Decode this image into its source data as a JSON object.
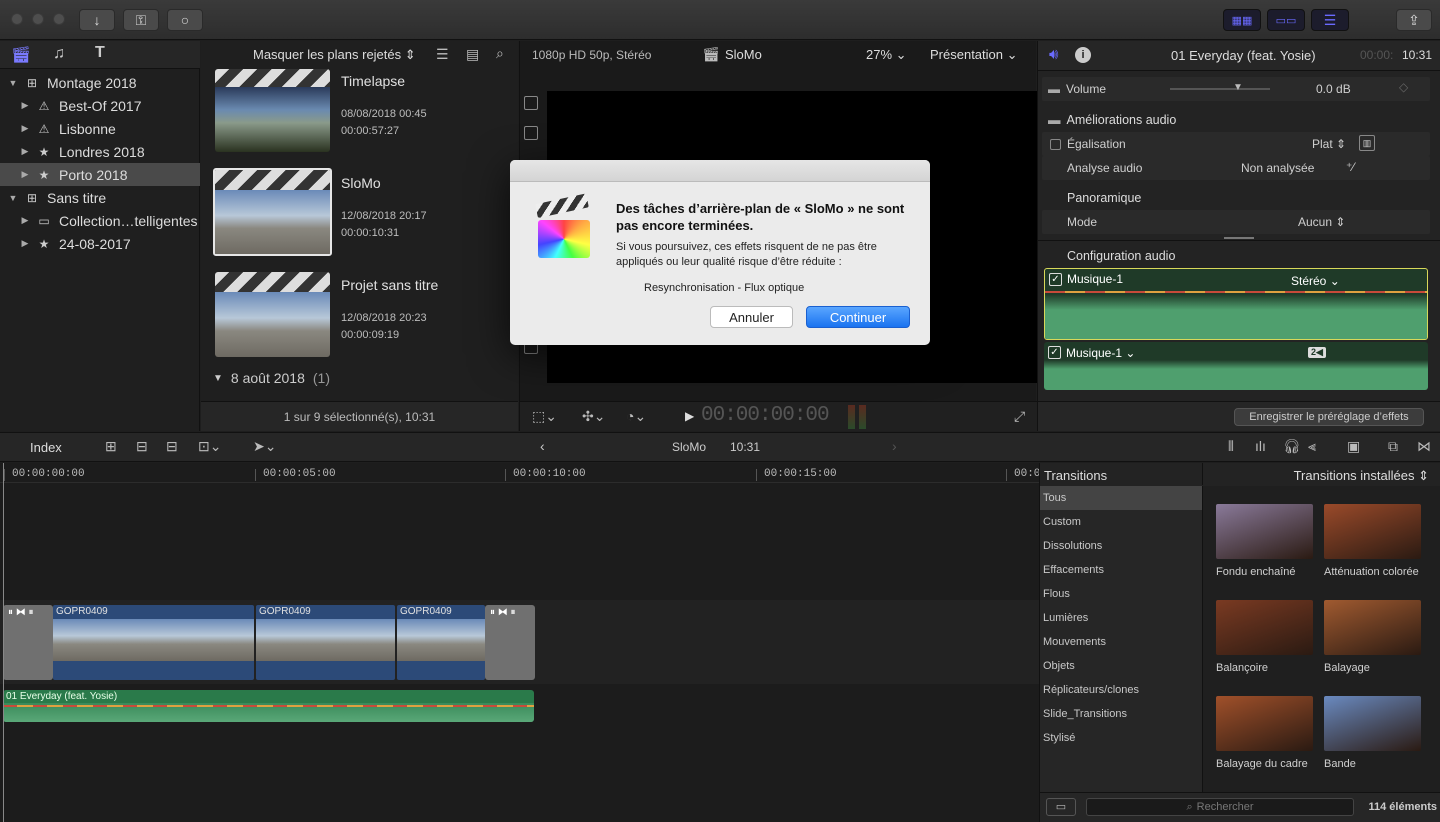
{
  "toolbar": {
    "import": "↓",
    "keywords": "⚿",
    "bg_tasks": "○",
    "share": "⇪"
  },
  "library": {
    "items": [
      {
        "label": "Montage 2018",
        "indent": 0,
        "tri": "▼",
        "icon": "library-icon"
      },
      {
        "label": "Best-Of 2017",
        "indent": 1,
        "tri": "▶",
        "icon": "event-warning-icon"
      },
      {
        "label": "Lisbonne",
        "indent": 1,
        "tri": "▶",
        "icon": "event-warning-icon"
      },
      {
        "label": "Londres 2018",
        "indent": 1,
        "tri": "▶",
        "icon": "event-star-icon"
      },
      {
        "label": "Porto 2018",
        "indent": 1,
        "tri": "▶",
        "icon": "event-star-icon"
      },
      {
        "label": "Sans titre",
        "indent": 0,
        "tri": "▼",
        "icon": "library-icon"
      },
      {
        "label": "Collection…telligentes",
        "indent": 1,
        "tri": "▶",
        "icon": "folder-icon"
      },
      {
        "label": "24-08-2017",
        "indent": 1,
        "tri": "▶",
        "icon": "event-star-icon"
      }
    ],
    "selected_index": 4
  },
  "browser": {
    "filter": "Masquer les plans rejetés ⇕",
    "clips": [
      {
        "name": "Timelapse",
        "date": "08/08/2018 00:45",
        "duration": "00:00:57:27"
      },
      {
        "name": "SloMo",
        "date": "12/08/2018 20:17",
        "duration": "00:00:10:31"
      },
      {
        "name": "Projet sans titre",
        "date": "12/08/2018 20:23",
        "duration": "00:00:09:19"
      }
    ],
    "group": "8 août 2018",
    "group_count": "(1)",
    "status": "1 sur 9 sélectionné(s), 10:31"
  },
  "viewer": {
    "format": "1080p HD 50p, Stéréo",
    "project": "SloMo",
    "zoom": "27% ⌄",
    "view": "Présentation ⌄",
    "timecode": "00:00:00:00"
  },
  "inspector": {
    "title": "01 Everyday (feat. Yosie)",
    "duration_dim": "00:00:",
    "duration": "10:31",
    "volume_label": "Volume",
    "volume_value": "0.0 dB",
    "enhance": "Améliorations audio",
    "eq_label": "Égalisation",
    "eq_value": "Plat ⇕",
    "analysis_label": "Analyse audio",
    "analysis_value": "Non analysée",
    "pan": "Panoramique",
    "mode_label": "Mode",
    "mode_value": "Aucun ⇕",
    "config": "Configuration audio",
    "ch1_name": "Musique-1",
    "ch1_mode": "Stéréo ⌄",
    "ch2_name": "Musique-1 ⌄",
    "ch2_badge": "2◀",
    "save_preset": "Enregistrer le préréglage d’effets"
  },
  "dialog": {
    "title": "Des tâches d’arrière-plan de « SloMo » ne sont pas encore terminées.",
    "body": "Si vous poursuivez, ces effets risquent de ne pas être appliqués ou leur qualité risque d’être réduite :",
    "task": "Resynchronisation - Flux optique",
    "cancel": "Annuler",
    "continue": "Continuer"
  },
  "timeline": {
    "index": "Index",
    "project": "SloMo",
    "duration": "10:31",
    "ruler": [
      "00:00:00:00",
      "00:00:05:00",
      "00:00:10:00",
      "00:00:15:00",
      "00:0"
    ],
    "clips": [
      "GOPR0409",
      "GOPR0409",
      "GOPR0409"
    ],
    "audio": "01 Everyday (feat. Yosie)"
  },
  "transitions": {
    "header": "Transitions",
    "installed": "Transitions installées ⇕",
    "categories": [
      "Tous",
      "Custom",
      "Dissolutions",
      "Effacements",
      "Flous",
      "Lumières",
      "Mouvements",
      "Objets",
      "Réplicateurs/clones",
      "Slide_Transitions",
      "Stylisé"
    ],
    "selected_index": 0,
    "items": [
      {
        "label": "Fondu enchaîné",
        "color": "#8a7a9a"
      },
      {
        "label": "Atténuation colorée",
        "color": "#9a4a2a"
      },
      {
        "label": "Balançoire",
        "color": "#7a3a22"
      },
      {
        "label": "Balayage",
        "color": "#a05a30"
      },
      {
        "label": "Balayage du cadre",
        "color": "#a0502a"
      },
      {
        "label": "Bande",
        "color": "#6a8ac0"
      }
    ],
    "search_placeholder": "Rechercher",
    "count": "114 éléments"
  },
  "colors": {
    "accent": "#2a7ef5",
    "audio": "#4f9f6e",
    "video": "#2c4a78"
  }
}
